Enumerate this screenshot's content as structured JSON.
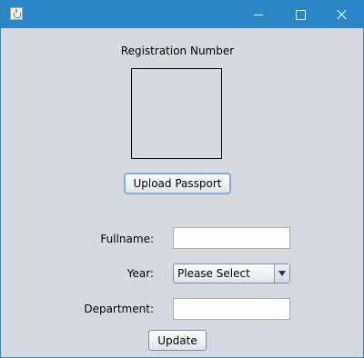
{
  "titlebar": {
    "app_icon": "java-coffee-cup-icon",
    "controls": [
      "minimize-icon",
      "maximize-icon",
      "close-icon"
    ]
  },
  "registration": {
    "label": "Registration Number"
  },
  "photo": {
    "upload_button": "Upload Passport"
  },
  "form": {
    "fullname_label": "Fullname:",
    "fullname_value": "",
    "year_label": "Year:",
    "year_selected": "Please Select",
    "department_label": "Department:",
    "department_value": "",
    "update_button": "Update"
  }
}
